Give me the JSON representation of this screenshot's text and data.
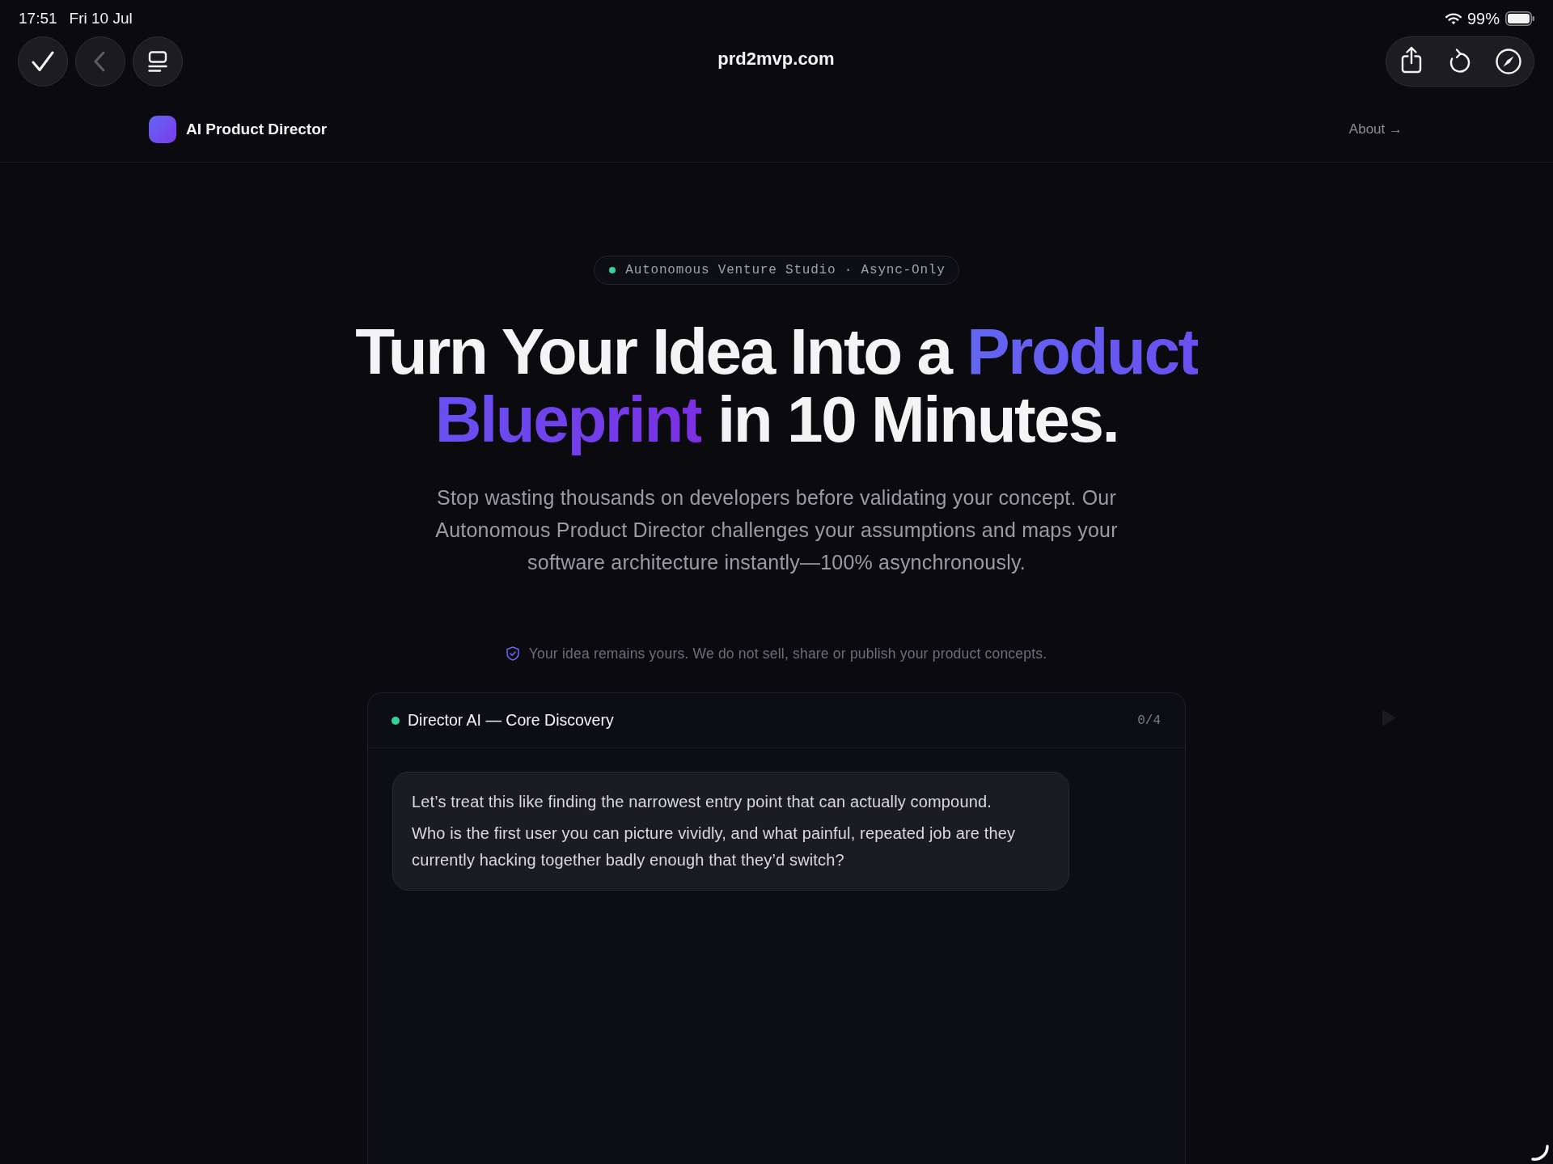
{
  "status_bar": {
    "time": "17:51",
    "date": "Fri 10 Jul",
    "battery": "99%"
  },
  "browser": {
    "url": "prd2mvp.com",
    "back_disabled": true
  },
  "site_nav": {
    "brand": "AI Product Director",
    "link": "About →"
  },
  "hero": {
    "badge": "Autonomous Venture Studio · Async-Only",
    "headline": [
      {
        "text": "Turn Your Idea Into a ",
        "accent": false
      },
      {
        "text": "Product Blueprint",
        "accent": true
      },
      {
        "text": " in 10 Minutes.",
        "accent": false
      }
    ],
    "subtitle": "Stop wasting thousands on developers before validating your concept. Our Autonomous Product Director challenges your assumptions and maps your software architecture instantly—100% asynchronously.",
    "privacy_note": "Your idea remains yours. We do not sell, share or publish your product concepts."
  },
  "chat": {
    "title": "Director AI — Core Discovery",
    "counter": "0/4",
    "messages": [
      {
        "paragraphs": [
          "Let’s treat this like finding the narrowest entry point that can actually compound.",
          "Who is the first user you can picture vividly, and what painful, repeated job are they currently hacking together badly enough that they’d switch?"
        ]
      }
    ]
  }
}
